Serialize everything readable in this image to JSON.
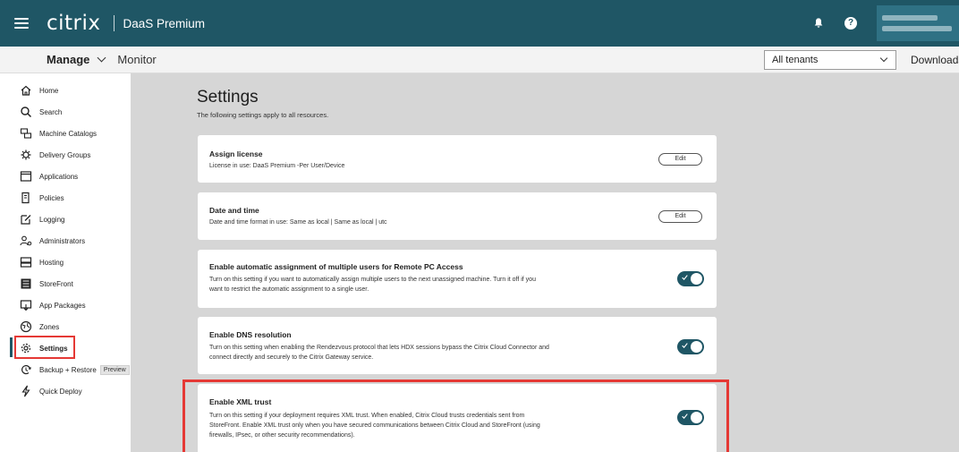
{
  "header": {
    "brand": "citrix",
    "product": "DaaS Premium"
  },
  "nav": {
    "manage_label": "Manage",
    "monitor_label": "Monitor",
    "tenant_select": "All tenants",
    "downloads_label": "Downloads"
  },
  "sidebar": {
    "items": [
      {
        "label": "Home",
        "icon": "home-icon"
      },
      {
        "label": "Search",
        "icon": "search-icon"
      },
      {
        "label": "Machine Catalogs",
        "icon": "machine-catalogs-icon"
      },
      {
        "label": "Delivery Groups",
        "icon": "delivery-groups-icon"
      },
      {
        "label": "Applications",
        "icon": "applications-icon"
      },
      {
        "label": "Policies",
        "icon": "policies-icon"
      },
      {
        "label": "Logging",
        "icon": "logging-icon"
      },
      {
        "label": "Administrators",
        "icon": "administrators-icon"
      },
      {
        "label": "Hosting",
        "icon": "hosting-icon"
      },
      {
        "label": "StoreFront",
        "icon": "storefront-icon"
      },
      {
        "label": "App Packages",
        "icon": "app-packages-icon"
      },
      {
        "label": "Zones",
        "icon": "zones-icon"
      },
      {
        "label": "Settings",
        "icon": "gear-icon"
      },
      {
        "label": "Backup + Restore",
        "icon": "backup-restore-icon"
      },
      {
        "label": "Quick Deploy",
        "icon": "quick-deploy-icon"
      }
    ],
    "preview_badge": "Preview",
    "active_item": "Settings"
  },
  "main": {
    "title": "Settings",
    "subtitle": "The following settings apply to all resources.",
    "cards": [
      {
        "title": "Assign license",
        "description": "License in use: DaaS Premium -Per User/Device",
        "control": "edit",
        "edit_label": "Edit"
      },
      {
        "title": "Date and time",
        "description": "Date and time format in use: Same as local | Same as local | utc",
        "control": "edit",
        "edit_label": "Edit"
      },
      {
        "title": "Enable automatic assignment of multiple users for Remote PC Access",
        "description_lines": [
          "Turn on this setting if you want to automatically assign multiple users to the next unassigned machine. Turn it off if you",
          "want to restrict the automatic assignment to a single user."
        ],
        "control": "toggle",
        "enabled": true
      },
      {
        "title": "Enable DNS resolution",
        "description_lines": [
          "Turn on this setting when enabling the Rendezvous protocol that lets HDX sessions bypass the Citrix Cloud Connector and",
          "connect directly and securely to the Citrix Gateway service."
        ],
        "control": "toggle",
        "enabled": true
      },
      {
        "title": "Enable XML trust",
        "description_lines": [
          "Turn on this setting if your deployment requires XML trust. When enabled, Citrix Cloud trusts credentials sent from",
          "StoreFront. Enable XML trust only when you have secured communications between Citrix Cloud and StoreFront (using",
          "firewalls, IPsec, or other security recommendations)."
        ],
        "control": "toggle",
        "enabled": true
      }
    ]
  },
  "colors": {
    "header_bg": "#1f5665",
    "toggle_on": "#1f5665",
    "highlight": "#e53935",
    "main_bg": "#d6d6d6"
  }
}
